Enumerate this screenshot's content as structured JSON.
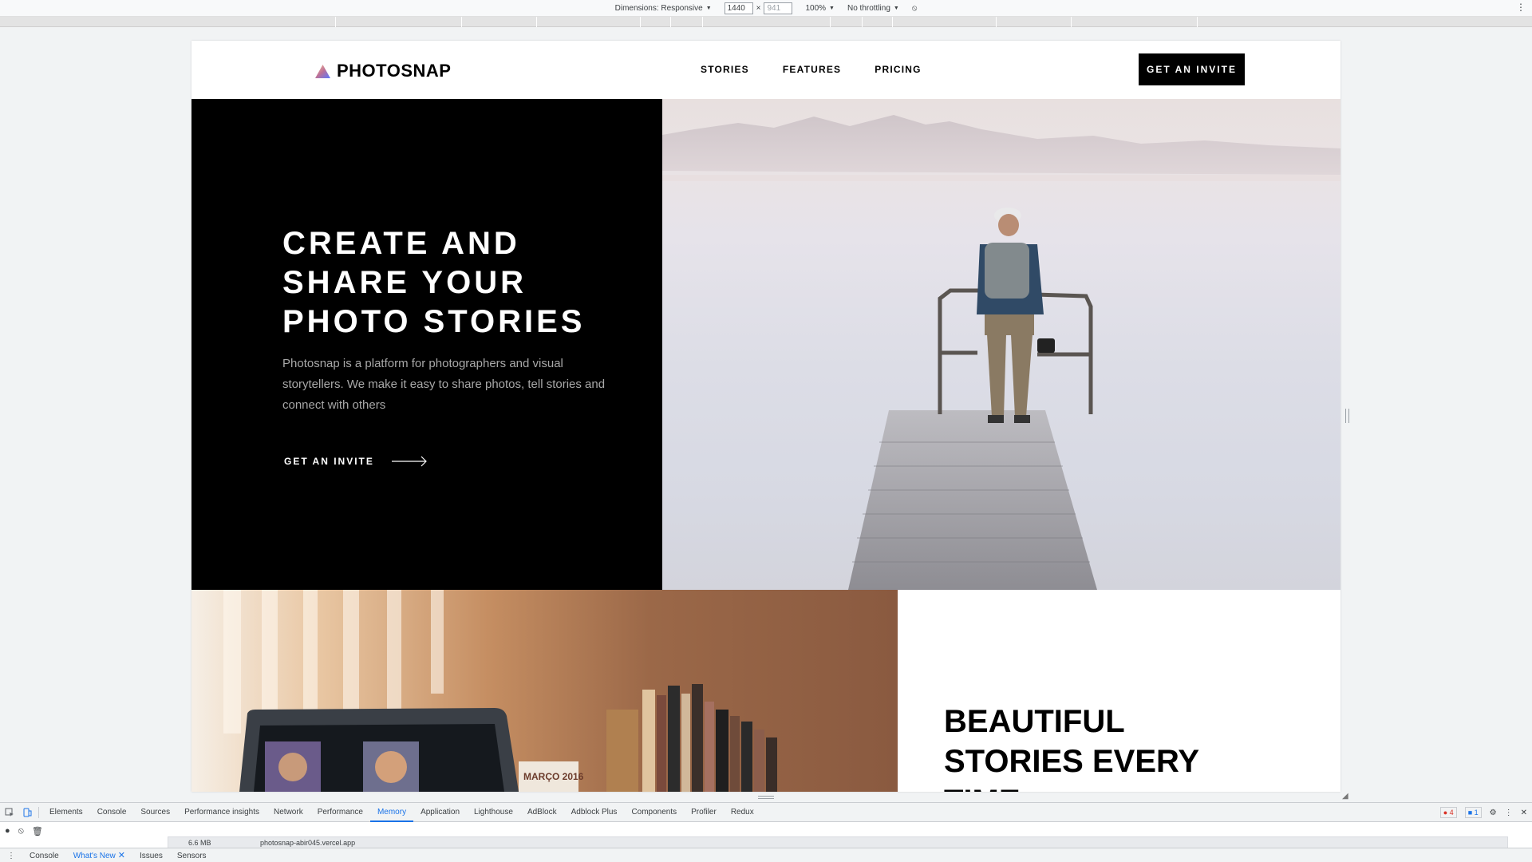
{
  "toolbar": {
    "dimensions_label": "Dimensions: Responsive",
    "width": "1440",
    "height": "941",
    "zoom": "100%",
    "throttling": "No throttling"
  },
  "site": {
    "logo_text": "PHOTOSNAP",
    "nav": [
      "STORIES",
      "FEATURES",
      "PRICING"
    ],
    "header_cta": "GET AN INVITE",
    "hero": {
      "title": "CREATE AND\nSHARE YOUR\nPHOTO STORIES",
      "description": "Photosnap is a platform for photographers and visual storytellers. We make it easy to share photos, tell stories and connect with others",
      "link_label": "GET AN INVITE"
    },
    "section2": {
      "title": "BEAUTIFUL STORIES EVERY TIME"
    },
    "laptop_screen_text": "MARÇO 2016"
  },
  "devtools": {
    "tabs": [
      "Elements",
      "Console",
      "Sources",
      "Performance insights",
      "Network",
      "Performance",
      "Memory",
      "Application",
      "Lighthouse",
      "AdBlock",
      "Adblock Plus",
      "Components",
      "Profiler",
      "Redux"
    ],
    "active_tab": "Memory",
    "error_count": "4",
    "message_count": "1",
    "heap_size": "6.6 MB",
    "heap_url": "photosnap-abir045.vercel.app",
    "drawer_tabs": [
      "Console",
      "What's New",
      "Issues",
      "Sensors"
    ],
    "active_drawer_tab": "What's New"
  },
  "colors": {
    "accent": "#1a73e8",
    "hero_bg": "#000000",
    "logo_gradient": [
      "#ffc593",
      "#bc7198",
      "#5a77ff"
    ]
  }
}
